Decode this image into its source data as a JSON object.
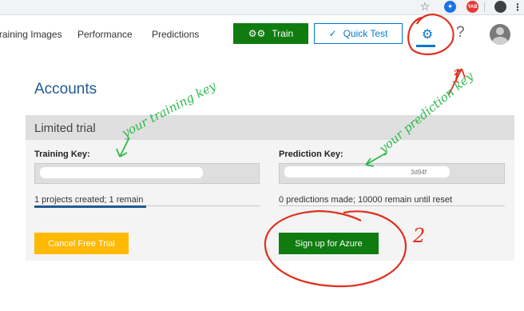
{
  "browser": {
    "star_icon": "☆",
    "extension_badge_text": "YAB"
  },
  "header": {
    "nav": [
      "Training Images",
      "Performance",
      "Predictions"
    ],
    "train_label": "Train",
    "quick_test_label": "Quick Test",
    "help_label": "?"
  },
  "accounts": {
    "title": "Accounts",
    "plan": "Limited trial",
    "training_key_label": "Training Key:",
    "prediction_key_label": "Prediction Key:",
    "prediction_key_visible_tail": "3d94f",
    "training_usage": "1 projects created; 1 remain",
    "training_usage_fraction": 0.5,
    "prediction_usage": "0 predictions made; 10000 remain until reset",
    "cancel_label": "Cancel Free Trial",
    "signup_label": "Sign up for Azure"
  },
  "annotations": {
    "note_training": "your training key",
    "note_prediction": "your prediction key",
    "marker_1": "1",
    "marker_2": "2"
  },
  "colors": {
    "brand_blue": "#0078d4",
    "train_green": "#107c10",
    "cancel_yellow": "#ffb900",
    "annotation_red": "#e0301e",
    "annotation_green": "#2db84d"
  }
}
